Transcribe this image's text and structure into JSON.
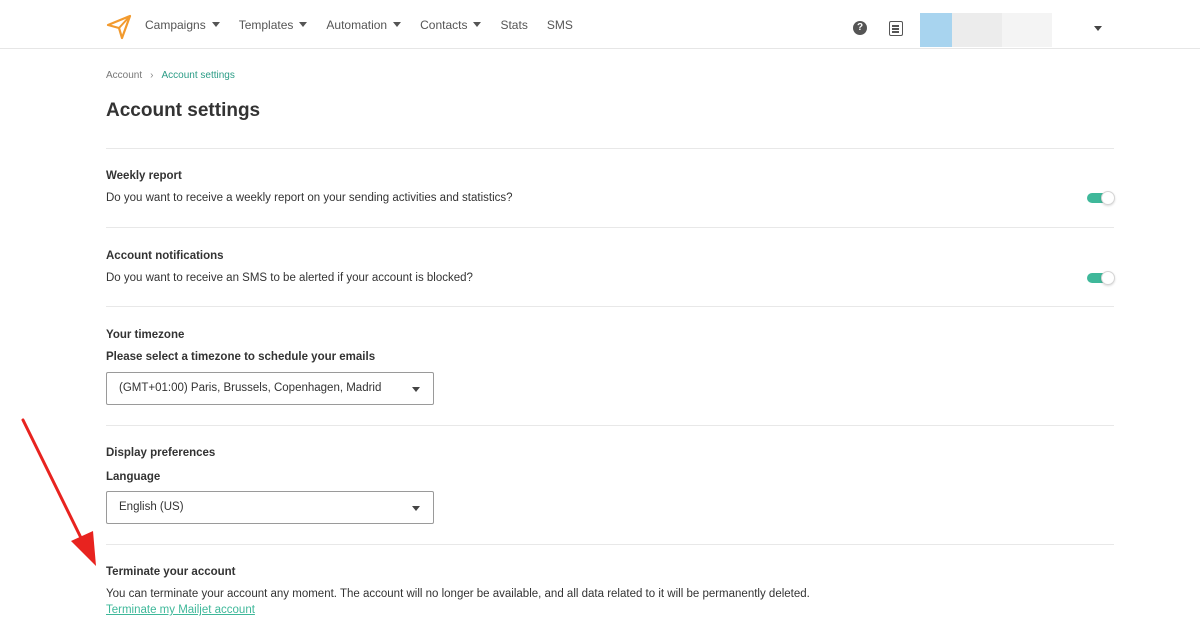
{
  "nav": {
    "items": [
      {
        "label": "Campaigns",
        "has_caret": true
      },
      {
        "label": "Templates",
        "has_caret": true
      },
      {
        "label": "Automation",
        "has_caret": true
      },
      {
        "label": "Contacts",
        "has_caret": true
      },
      {
        "label": "Stats",
        "has_caret": false
      },
      {
        "label": "SMS",
        "has_caret": false
      }
    ],
    "help_glyph": "?",
    "icons": {
      "logo": "paper-plane-icon",
      "help": "help-icon",
      "docs": "document-icon",
      "account_menu": "chevron-down-icon"
    }
  },
  "breadcrumb": {
    "root": "Account",
    "separator": "›",
    "current": "Account settings"
  },
  "page": {
    "title": "Account settings"
  },
  "sections": {
    "weekly_report": {
      "title": "Weekly report",
      "description": "Do you want to receive a weekly report on your sending activities and statistics?",
      "enabled": true
    },
    "notifications": {
      "title": "Account notifications",
      "description": "Do you want to receive an SMS to be alerted if your account is blocked?",
      "enabled": true
    },
    "timezone": {
      "title": "Your timezone",
      "label": "Please select a timezone to schedule your emails",
      "selected": "(GMT+01:00) Paris, Brussels, Copenhagen, Madrid"
    },
    "display": {
      "title": "Display preferences",
      "language_label": "Language",
      "language_selected": "English (US)"
    },
    "terminate": {
      "title": "Terminate your account",
      "description": "You can terminate your account any moment. The account will no longer be available, and all data related to it will be permanently deleted.",
      "link": "Terminate my Mailjet account"
    }
  },
  "colors": {
    "accent": "#3fb89a",
    "breadcrumb_active": "#2b9c86",
    "logo": "#f29a2e",
    "annotation_arrow": "#e8231f"
  }
}
